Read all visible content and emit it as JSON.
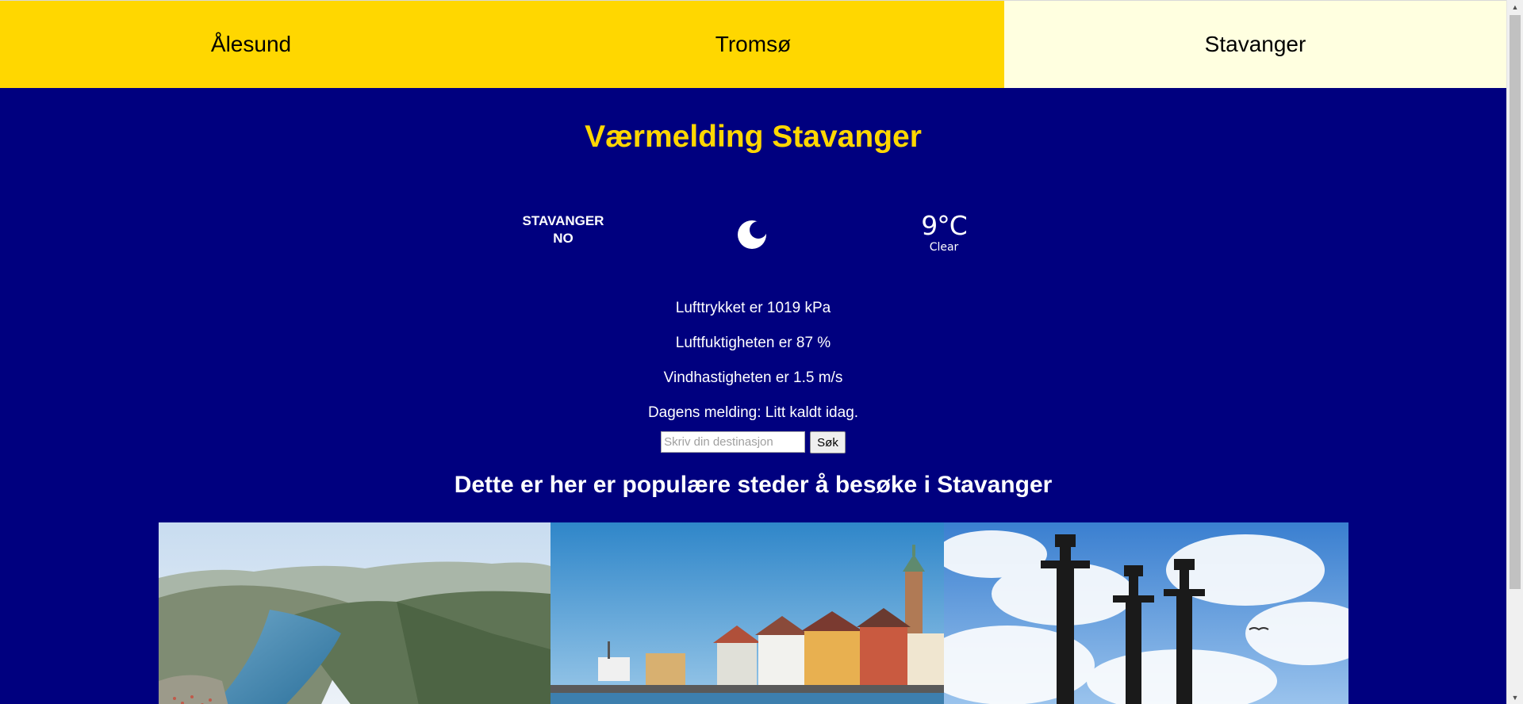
{
  "tabs": [
    {
      "label": "Ålesund",
      "active": false
    },
    {
      "label": "Tromsø",
      "active": false
    },
    {
      "label": "Stavanger",
      "active": true
    }
  ],
  "colors": {
    "background": "#00007f",
    "tab_inactive": "#ffd700",
    "tab_active": "#ffffe0",
    "title": "#ffd700",
    "text": "#ffffff"
  },
  "heading": "Værmelding Stavanger",
  "weather": {
    "city": "STAVANGER",
    "country": "NO",
    "icon": "moon-icon",
    "temperature": "9°C",
    "description": "Clear"
  },
  "details": {
    "pressure": "Lufttrykket er 1019 kPa",
    "humidity": "Luftfuktigheten er 87 %",
    "wind": "Vindhastigheten er 1.5 m/s",
    "message": "Dagens melding: Litt kaldt idag."
  },
  "search": {
    "placeholder": "Skriv din destinasjon",
    "button_label": "Søk"
  },
  "popular": {
    "title": "Dette er her er populære steder å besøke i Stavanger"
  }
}
